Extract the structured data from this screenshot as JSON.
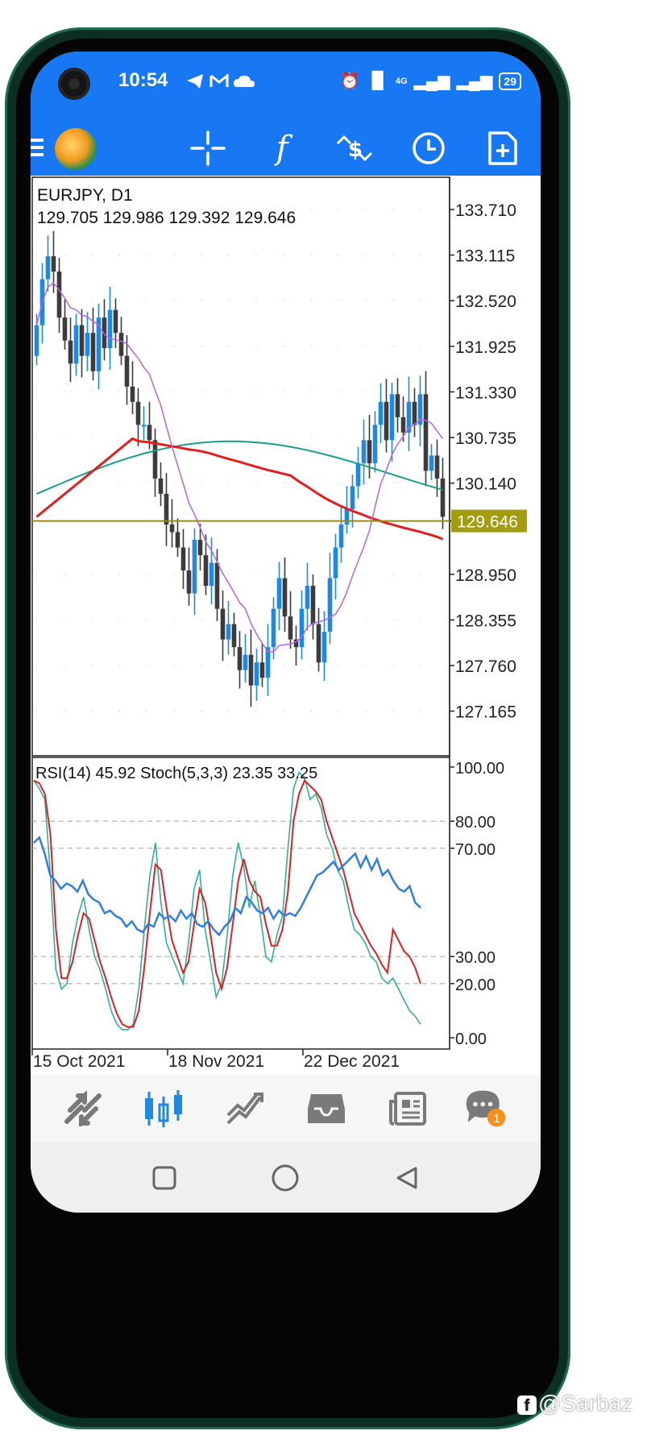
{
  "statusbar": {
    "time": "10:54",
    "notification_icons": "telegram-icon gmail-icon cloud-icon",
    "right_icons": "alarm-icon vibrate-icon signal-icon signal-icon",
    "network": "4G",
    "battery": "29"
  },
  "toolbar": {
    "buttons": [
      "menu-icon",
      "app-logo",
      "crosshair-icon",
      "indicators-icon",
      "trade-icon",
      "timeframe-icon",
      "new-order-icon"
    ],
    "indicators_label": "f"
  },
  "chart": {
    "symbol": "EURJPY, D1",
    "ohlc": "129.705 129.986 129.392 129.646",
    "price_labels": [
      "133.710",
      "133.115",
      "132.520",
      "131.925",
      "131.330",
      "130.735",
      "130.140",
      "129.646",
      "128.950",
      "128.355",
      "127.760",
      "127.165"
    ],
    "current_price_tag": "129.646",
    "indicator_header": "RSI(14) 45.92 Stoch(5,3,3) 23.35 33.25",
    "indicator_levels": [
      "100.00",
      "80.00",
      "70.00",
      "30.00",
      "20.00",
      "0.00"
    ],
    "date_labels": [
      "15 Oct 2021",
      "18 Nov 2021",
      "22 Dec 2021"
    ],
    "colors": {
      "bull": "#1e88e5",
      "bear": "#3c3c3c",
      "ma_fast": "#b265e8",
      "ma_mid": "#e02020",
      "ma_slow": "#1c9c8a",
      "price_line": "#9a8a14",
      "price_tag_bg": "#a39b10",
      "rsi": "#2f7fe3",
      "stoch_main": "#2cb29a",
      "stoch_signal": "#e02020"
    }
  },
  "bottom_nav": {
    "items": [
      "quotes-icon",
      "chart-icon",
      "trade-icon",
      "history-icon",
      "news-icon",
      "messages-icon"
    ],
    "messages_badge": "1"
  },
  "system_nav": [
    "recent-apps-button",
    "home-button",
    "back-button"
  ],
  "watermark": "@Sarbaz"
}
